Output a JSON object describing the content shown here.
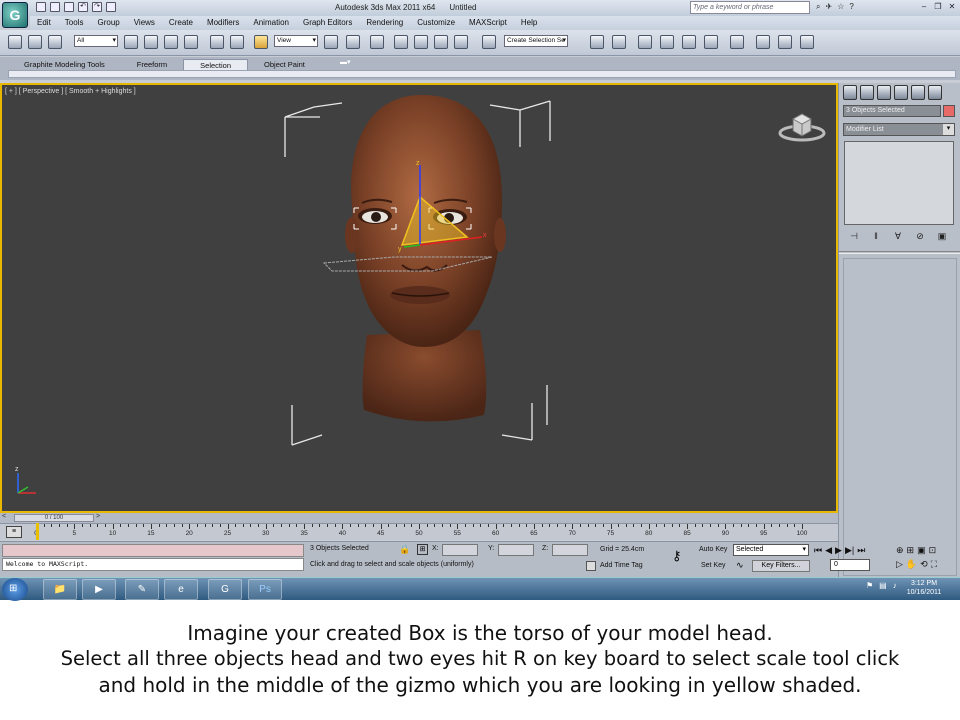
{
  "window": {
    "app_title": "Autodesk 3ds Max 2011 x64",
    "doc_title": "Untitled",
    "search_placeholder": "Type a keyword or phrase"
  },
  "menus": [
    "Edit",
    "Tools",
    "Group",
    "Views",
    "Create",
    "Modifiers",
    "Animation",
    "Graph Editors",
    "Rendering",
    "Customize",
    "MAXScript",
    "Help"
  ],
  "toolbar": {
    "selection_filter": "All",
    "ref_coord": "View",
    "named_selection": "Create Selection Se"
  },
  "ribbon": {
    "tabs": [
      "Graphite Modeling Tools",
      "Freeform",
      "Selection",
      "Object Paint"
    ],
    "active_tab": "Selection"
  },
  "viewport": {
    "label": "[ + ] [ Perspective ] [ Smooth + Highlights ]"
  },
  "command_panel": {
    "object_name": "3 Objects Selected",
    "object_color": "#e86a68",
    "modifier_list": "Modifier List"
  },
  "timeline": {
    "slider": "0 / 100",
    "ticks": [
      0,
      5,
      10,
      15,
      20,
      25,
      30,
      35,
      40,
      45,
      50,
      55,
      60,
      65,
      70,
      75,
      80,
      85,
      90,
      95,
      100
    ]
  },
  "status": {
    "listener_text": "Welcome to MAXScript.",
    "selection_count": "3 Objects Selected",
    "prompt": "Click and drag to select and scale objects (uniformly)",
    "x_label": "X:",
    "y_label": "Y:",
    "z_label": "Z:",
    "grid": "Grid = 25.4cm",
    "add_time_tag": "Add Time Tag",
    "auto_key": "Auto Key",
    "set_key": "Set Key",
    "key_mode": "Selected",
    "key_filters": "Key Filters...",
    "frame": "0"
  },
  "taskbar": {
    "time": "3:12 PM",
    "date": "10/16/2011",
    "apps": [
      "explorer",
      "media-player",
      "notepad",
      "internet-explorer",
      "3ds-max",
      "photoshop"
    ]
  },
  "caption": {
    "line1": "Imagine your created Box is the torso of your model head.",
    "line2": "Select all three objects head and two eyes hit R on key board to select scale tool click",
    "line3": "and hold in the middle of the gizmo which you are looking in yellow shaded."
  }
}
